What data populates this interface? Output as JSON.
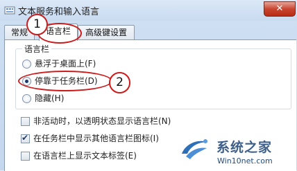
{
  "window": {
    "title": "文本服务和输入语言",
    "close_label": "✕"
  },
  "tabs": [
    {
      "label": "常规"
    },
    {
      "label": "语言栏"
    },
    {
      "label": "高级键设置"
    }
  ],
  "language_bar_group": {
    "title": "语言栏",
    "options": [
      {
        "label": "悬浮于桌面上(F)",
        "selected": false
      },
      {
        "label": "停靠于任务栏(D)",
        "selected": true
      },
      {
        "label": "隐藏(H)",
        "selected": false
      }
    ]
  },
  "checkboxes": [
    {
      "label": "非活动时，以透明状态显示语言栏(N)",
      "checked": false
    },
    {
      "label": "在任务栏中显示其他语言栏图标(I)",
      "checked": true
    },
    {
      "label": "在语言栏上显示文本标签(E)",
      "checked": false
    }
  ],
  "annotations": {
    "step1": "1",
    "step2": "2",
    "color": "#cc1b1b"
  },
  "watermark": {
    "title": "系统之家",
    "url": "Win10net.com"
  }
}
